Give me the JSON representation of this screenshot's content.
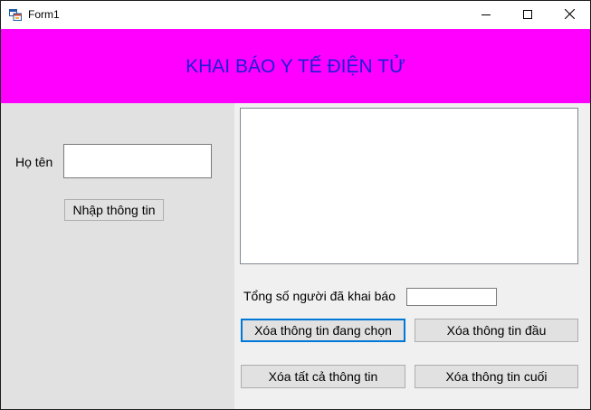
{
  "window": {
    "title": "Form1",
    "icons": {
      "app": "winforms-app-icon",
      "minimize": "minimize-icon",
      "maximize": "maximize-icon",
      "close": "close-icon"
    }
  },
  "header": {
    "title": "KHAI BÁO Y TẾ ĐIỆN TỬ",
    "background": "#ff00ff",
    "text_color": "#1d1dd6"
  },
  "left": {
    "name_label": "Họ tên",
    "name_value": "",
    "submit_label": "Nhập thông tin"
  },
  "right": {
    "list_items": [],
    "total_label": "Tổng số người đã khai báo",
    "total_value": "",
    "buttons": {
      "delete_selected": "Xóa thông tin đang chọn",
      "delete_first": "Xóa thông tin đầu",
      "delete_all": "Xóa tất cả thông tin",
      "delete_last": "Xóa thông tin cuối"
    }
  }
}
